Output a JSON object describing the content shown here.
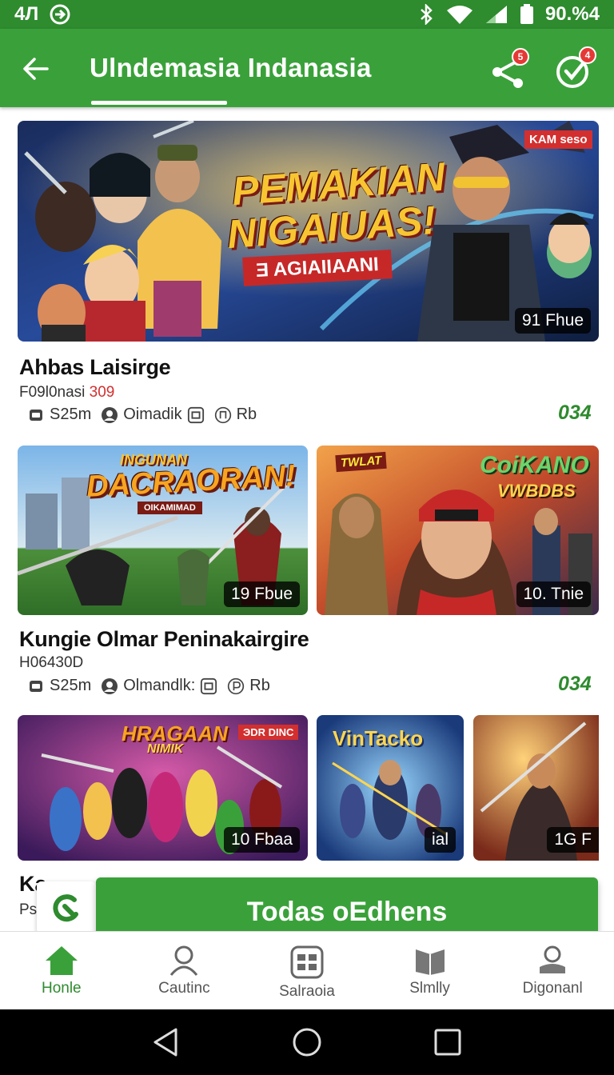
{
  "status": {
    "time": "4Л",
    "battery": "90.%4"
  },
  "appbar": {
    "title": "Ulndemasia Indanasia",
    "share_badge": "5",
    "check_badge": "4"
  },
  "featured": {
    "banner_line1": "PEMAKIAN",
    "banner_line2": "NIGAIUAS!",
    "banner_tag": "Ǝ AGIAIIAANI",
    "corner_tag": "KAM seso",
    "duration": "91 Fhue",
    "title": "Ahbas Laisirge",
    "sub_prefix": "F09l0nasi ",
    "sub_highlight": "309",
    "meta_size": "S25m",
    "meta_author": "Oimadik",
    "meta_extra": "Rb",
    "count": "034"
  },
  "row2": {
    "left": {
      "banner": "DACRAORAN!",
      "banner_top": "INGUNAN",
      "banner_small": "OIKAMIMAD",
      "duration": "19 Fbue"
    },
    "right": {
      "banner": "CoiKANO",
      "banner_sub": "VWBDBS",
      "corner": "TWLAT",
      "duration": "10. Tnie"
    },
    "title": "Kungie Olmar Peninakairgire",
    "sub": "H06430D",
    "meta_size": "S25m",
    "meta_author": "Olmandlk:",
    "meta_extra": "Rb",
    "count": "034"
  },
  "row3": {
    "a": {
      "banner": "HRAGAAN",
      "banner_sub": "NIMIK",
      "corner": "ЭDR DINC",
      "duration": "10 Fbaa"
    },
    "b": {
      "banner": "VinTacko",
      "duration": "ial"
    },
    "c": {
      "duration": "1G F"
    },
    "title": "Ka",
    "sub": "Ps"
  },
  "cta": {
    "label": "Todas oEdhens"
  },
  "nav": [
    {
      "label": "Honle"
    },
    {
      "label": "Cautinc"
    },
    {
      "label": "Salraoia"
    },
    {
      "label": "Slmlly"
    },
    {
      "label": "Digonanl"
    }
  ],
  "colors": {
    "primary": "#3aa13a",
    "primary_dark": "#2e8b2e",
    "badge": "#e53935",
    "count": "#2e8b2e"
  }
}
